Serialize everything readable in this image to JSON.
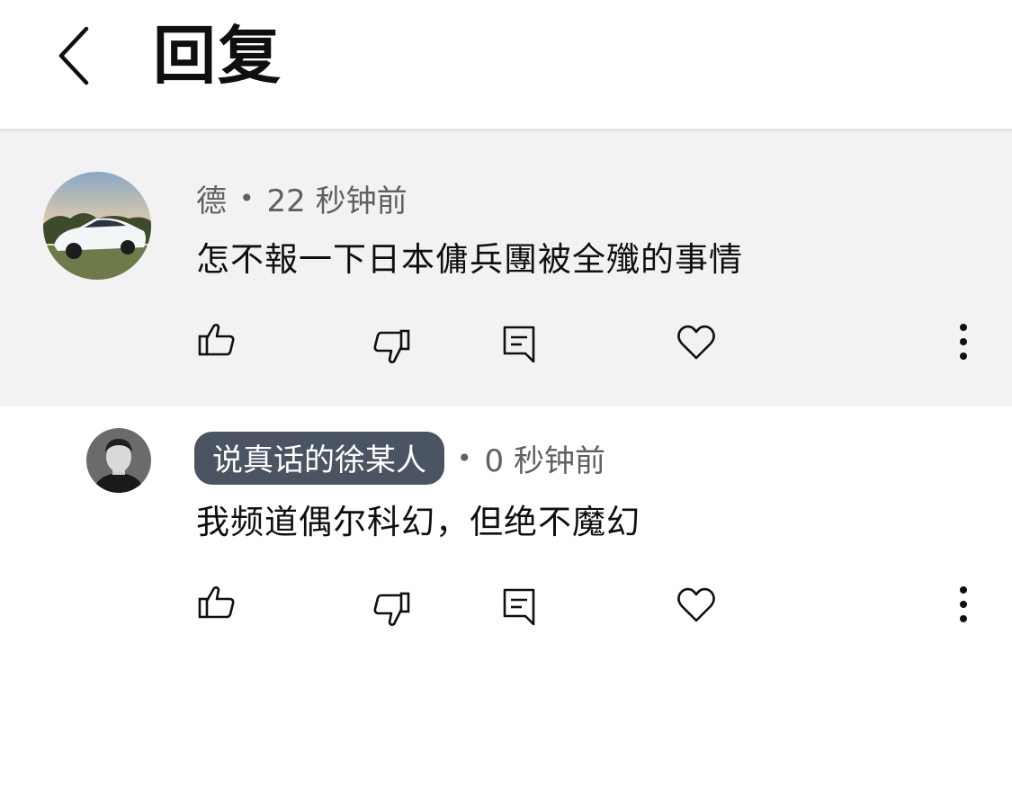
{
  "header": {
    "back_icon": "chevron-left-icon",
    "title": "回复"
  },
  "comments": [
    {
      "author": "德",
      "separator": "•",
      "time": "22 秒钟前",
      "text": "怎不報一下日本傭兵團被全殲的事情",
      "avatar": "car-photo-avatar",
      "actions": [
        "thumbs-up-icon",
        "thumbs-down-icon",
        "reply-icon",
        "heart-icon",
        "more-vert-icon"
      ]
    },
    {
      "author": "说真话的徐某人",
      "separator": "•",
      "time": "0 秒钟前",
      "text": "我频道偶尔科幻，但绝不魔幻",
      "avatar": "person-photo-avatar",
      "author_badge_color": "#4a5462",
      "actions": [
        "thumbs-up-icon",
        "thumbs-down-icon",
        "reply-icon",
        "heart-icon",
        "more-vert-icon"
      ]
    }
  ],
  "colors": {
    "parent_bg": "#f2f2f2",
    "meta_text": "#606060",
    "body_text": "#0f0f0f"
  }
}
